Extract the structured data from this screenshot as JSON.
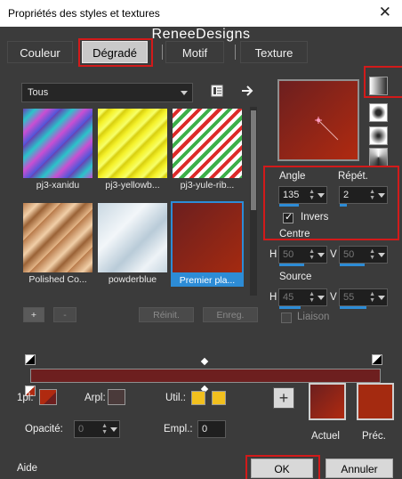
{
  "window": {
    "title": "Propriétés des styles et textures",
    "close_glyph": "✕",
    "watermark": "ReneeDesigns"
  },
  "tabs": [
    {
      "label": "Couleur"
    },
    {
      "label": "Dégradé"
    },
    {
      "label": "Motif"
    },
    {
      "label": "Texture"
    }
  ],
  "library": {
    "category": "Tous",
    "thumbnails": [
      {
        "label": "pj3-xanidu"
      },
      {
        "label": "pj3-yellowb..."
      },
      {
        "label": "pj3-yule-rib..."
      },
      {
        "label": "Polished Co..."
      },
      {
        "label": "powderblue"
      },
      {
        "label": "Premier pla..."
      }
    ],
    "buttons": {
      "add": "+",
      "remove": "-",
      "reset": "Réinit.",
      "save": "Enreg."
    }
  },
  "settings": {
    "angle_label": "Angle",
    "angle_value": "135",
    "repeat_label": "Répét.",
    "repeat_value": "2",
    "invert_label": "Invers",
    "invert_checked": true,
    "center_label": "Centre",
    "center_h_label": "H",
    "center_h_value": "50",
    "center_v_label": "V",
    "center_v_value": "50",
    "source_label": "Source",
    "source_h_label": "H",
    "source_h_value": "45",
    "source_v_label": "V",
    "source_v_value": "55",
    "link_label": "Liaison"
  },
  "stops": {
    "stop_label": "1pl:",
    "bgstop_label": "Arpl:",
    "use_label": "Util.:",
    "opacity_label": "Opacité:",
    "opacity_value": "0",
    "location_label": "Empl.:",
    "location_value": "0"
  },
  "colors": {
    "dark_red": "#6d1f1f",
    "rust": "#a42a10",
    "gold": "#f2c01e",
    "highlight": "#d21a1a"
  },
  "swatches": {
    "current_label": "Actuel",
    "previous_label": "Préc."
  },
  "footer": {
    "help": "Aide",
    "ok": "OK",
    "cancel": "Annuler"
  }
}
